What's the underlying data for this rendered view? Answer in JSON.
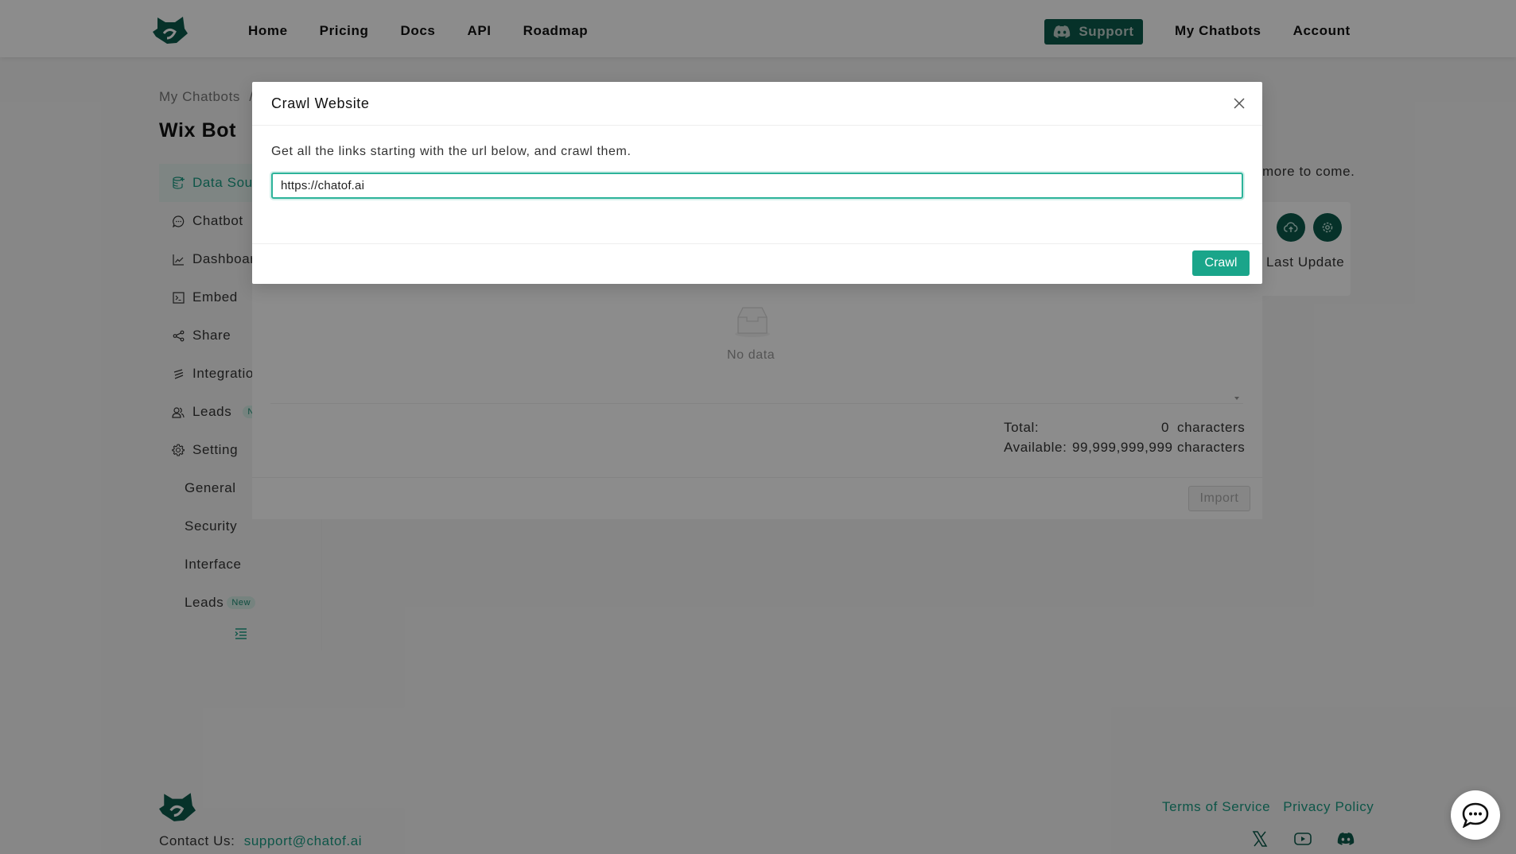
{
  "header": {
    "nav": [
      "Home",
      "Pricing",
      "Docs",
      "API",
      "Roadmap"
    ],
    "support_label": "Support",
    "right_nav": [
      "My Chatbots",
      "Account"
    ]
  },
  "breadcrumb": {
    "root": "My Chatbots",
    "separator": "/"
  },
  "page_title": "Wix Bot",
  "sidebar": {
    "items": [
      {
        "label": "Data Sources",
        "icon": "database-plus-icon",
        "active": true
      },
      {
        "label": "Chatbot",
        "icon": "chat-bubble-icon"
      },
      {
        "label": "Dashboard",
        "icon": "line-chart-icon"
      },
      {
        "label": "Embed",
        "icon": "terminal-icon"
      },
      {
        "label": "Share",
        "icon": "share-icon"
      },
      {
        "label": "Integrations",
        "icon": "integration-icon"
      },
      {
        "label": "Leads",
        "icon": "users-icon",
        "badge": "New"
      },
      {
        "label": "Setting",
        "icon": "gear-icon"
      }
    ],
    "sub_items": [
      {
        "label": "General"
      },
      {
        "label": "Security"
      },
      {
        "label": "Interface"
      },
      {
        "label": "Leads",
        "badge": "New"
      }
    ]
  },
  "main": {
    "note": "more to come.",
    "last_update_label": "Last Update",
    "empty_text": "No data",
    "stats": {
      "total_label": "Total:",
      "total_value": "0",
      "available_label": "Available:",
      "available_value": "99,999,999,999",
      "unit": "characters"
    },
    "import_label": "Import"
  },
  "modal": {
    "title": "Crawl Website",
    "description": "Get all the links starting with the url below, and crawl them.",
    "url_value": "https://chatof.ai",
    "crawl_label": "Crawl"
  },
  "footer": {
    "contact_label": "Contact Us:",
    "contact_email": "support@chatof.ai",
    "terms": "Terms of Service",
    "privacy": "Privacy Policy"
  },
  "colors": {
    "brand": "#0b5a4b",
    "accent": "#1aa58a"
  }
}
